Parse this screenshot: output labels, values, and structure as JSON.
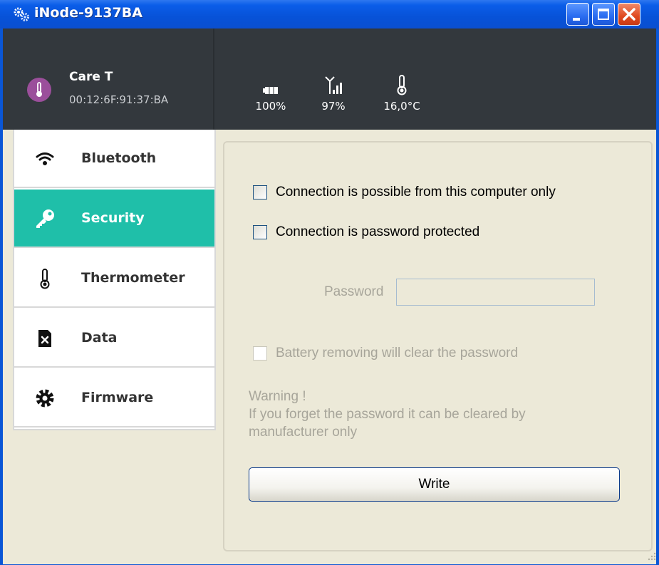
{
  "window": {
    "title": "iNode-9137BA",
    "icon": "gears-icon"
  },
  "device": {
    "name": "Care T",
    "mac": "00:12:6F:91:37:BA",
    "avatar_color": "#9b4f9b"
  },
  "stats": [
    {
      "icon": "battery-icon",
      "value": "100%"
    },
    {
      "icon": "signal-icon",
      "value": "97%"
    },
    {
      "icon": "thermometer-icon",
      "value": "16,0°C"
    }
  ],
  "sidebar": {
    "items": [
      {
        "label": "Bluetooth",
        "icon": "wifi-icon",
        "active": false
      },
      {
        "label": "Security",
        "icon": "key-icon",
        "active": true
      },
      {
        "label": "Thermometer",
        "icon": "thermometer-icon",
        "active": false
      },
      {
        "label": "Data",
        "icon": "file-delete-icon",
        "active": false
      },
      {
        "label": "Firmware",
        "icon": "gear-icon",
        "active": false
      }
    ]
  },
  "security": {
    "option_computer_only": "Connection is possible from this computer only",
    "option_password": "Connection is password protected",
    "password_label": "Password",
    "password_value": "",
    "option_battery_clear": "Battery removing will clear the password",
    "warning_title": "Warning !",
    "warning_text": "If you forget the password it can be cleared by manufacturer only",
    "write_label": "Write"
  },
  "colors": {
    "accent": "#1fbfa9",
    "header_bg": "#33383d",
    "titlebar": "#0752d8"
  }
}
